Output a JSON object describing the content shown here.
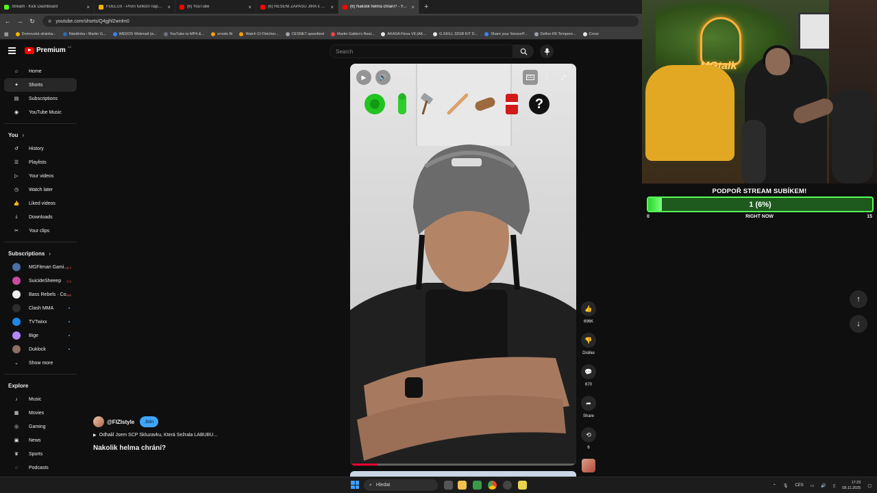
{
  "browser": {
    "tabs": [
      {
        "label": "Stream - Kick Dashboard",
        "color": "#53fc18",
        "active": false
      },
      {
        "label": "FUELUX - První funkční nápoj p...",
        "color": "#f0b400",
        "active": false
      },
      {
        "label": "(6) YouTube",
        "color": "#ff0000",
        "active": false
      },
      {
        "label": "(6) ŘEŠENÍ ZÁPASU JIRA x SIBI...",
        "color": "#ff0000",
        "active": false
      },
      {
        "label": "(6) Nakolik helma chrání? - You...",
        "color": "#ff0000",
        "active": true
      }
    ],
    "close_glyph": "×",
    "new_tab_glyph": "+",
    "url": "youtube.com/shorts/Q4gjhl2wnlm0",
    "bookmarks": [
      {
        "label": "Domovská stránka...",
        "color": "#f4b400"
      },
      {
        "label": "Nástěnka ‹ Martin G...",
        "color": "#2b6cb0"
      },
      {
        "label": "WEDOS Webmail (w...",
        "color": "#3b82f6"
      },
      {
        "label": "YouTube to MP4 &...",
        "color": "#6b7280"
      },
      {
        "label": "emotic fb",
        "color": "#f59e0b"
      },
      {
        "label": "Watch Ct Fletcher...",
        "color": "#f59e0b"
      },
      {
        "label": "CESNET speedtest",
        "color": "#9ca3af"
      },
      {
        "label": "Martin Gabko's Real...",
        "color": "#ef4444"
      },
      {
        "label": "AKASA Flexa V8 (AK...",
        "color": "#e5e7eb"
      },
      {
        "label": "G.SKILL 32GB KIT D...",
        "color": "#e5e7eb"
      },
      {
        "label": "Share your SensorP...",
        "color": "#3b82f6"
      },
      {
        "label": "Define R6 Tempere...",
        "color": "#9ca3af"
      },
      {
        "label": "Cross",
        "color": "#e5e7eb"
      }
    ]
  },
  "youtube": {
    "logo_text": "Premium",
    "logo_sup": "CZ",
    "search_placeholder": "Search",
    "sidebar": {
      "main": [
        {
          "label": "Home",
          "icon": "home-icon",
          "glyph": "⌂"
        },
        {
          "label": "Shorts",
          "icon": "shorts-icon",
          "glyph": "✦",
          "active": true
        },
        {
          "label": "Subscriptions",
          "icon": "subscriptions-icon",
          "glyph": "▤"
        },
        {
          "label": "YouTube Music",
          "icon": "music-circle-icon",
          "glyph": "◉"
        }
      ],
      "you_header": "You",
      "you": [
        {
          "label": "History",
          "icon": "history-icon",
          "glyph": "↺"
        },
        {
          "label": "Playlists",
          "icon": "playlists-icon",
          "glyph": "☰"
        },
        {
          "label": "Your videos",
          "icon": "your-videos-icon",
          "glyph": "▷"
        },
        {
          "label": "Watch later",
          "icon": "watch-later-icon",
          "glyph": "◷"
        },
        {
          "label": "Liked videos",
          "icon": "liked-icon",
          "glyph": "👍"
        },
        {
          "label": "Downloads",
          "icon": "download-icon",
          "glyph": "⤓"
        },
        {
          "label": "Your clips",
          "icon": "clips-icon",
          "glyph": "✂"
        }
      ],
      "subs_header": "Subscriptions",
      "subs": [
        {
          "label": "MGFitman Gami...",
          "color": "#4a6fa5",
          "badge": "live"
        },
        {
          "label": "SuicideSheeep",
          "color": "#c84b9e",
          "badge": "live"
        },
        {
          "label": "Bass Rebels · Co...",
          "color": "#eeeeee",
          "badge": "live"
        },
        {
          "label": "Clash MMA",
          "color": "#2d2d2d",
          "badge": "dot"
        },
        {
          "label": "TVTwixx",
          "color": "#1e88e5",
          "badge": "dot"
        },
        {
          "label": "Bige",
          "color": "#b388ff",
          "badge": "dot"
        },
        {
          "label": "Duklock",
          "color": "#8d6e63",
          "badge": "dot"
        }
      ],
      "show_more": "Show more",
      "explore_header": "Explore",
      "explore": [
        {
          "label": "Music",
          "icon": "music-note-icon",
          "glyph": "♪"
        },
        {
          "label": "Movies",
          "icon": "movies-icon",
          "glyph": "▦"
        },
        {
          "label": "Gaming",
          "icon": "gaming-icon",
          "glyph": "◎"
        },
        {
          "label": "News",
          "icon": "news-icon",
          "glyph": "▣"
        },
        {
          "label": "Sports",
          "icon": "sports-icon",
          "glyph": "♛"
        },
        {
          "label": "Podcasts",
          "icon": "podcasts-icon",
          "glyph": "◌"
        }
      ]
    },
    "short": {
      "channel": "@FIZIstyle",
      "join_label": "Join",
      "related_video": "Odhalil Jsem SCP Skluzavku, Která Sežrala LABUBU...",
      "title": "Nakolik helma chrání?",
      "progress": 0.12,
      "actions": {
        "likes": "696K",
        "dislike_label": "Dislike",
        "comments": "670",
        "share_label": "Share",
        "remix": "6"
      }
    }
  },
  "overlay": {
    "cam_sign": "MGtalk",
    "goal_title": "PODPOŘ STREAM SUBÍKEM!",
    "goal_value": "1 (6%)",
    "goal_progress": 0.06,
    "goal_min": "0",
    "goal_label": "RIGHT NOW",
    "goal_max": "15"
  },
  "taskbar": {
    "search_label": "Hledat",
    "lang": "CES",
    "time": "17:23",
    "date": "08.11.2025"
  }
}
